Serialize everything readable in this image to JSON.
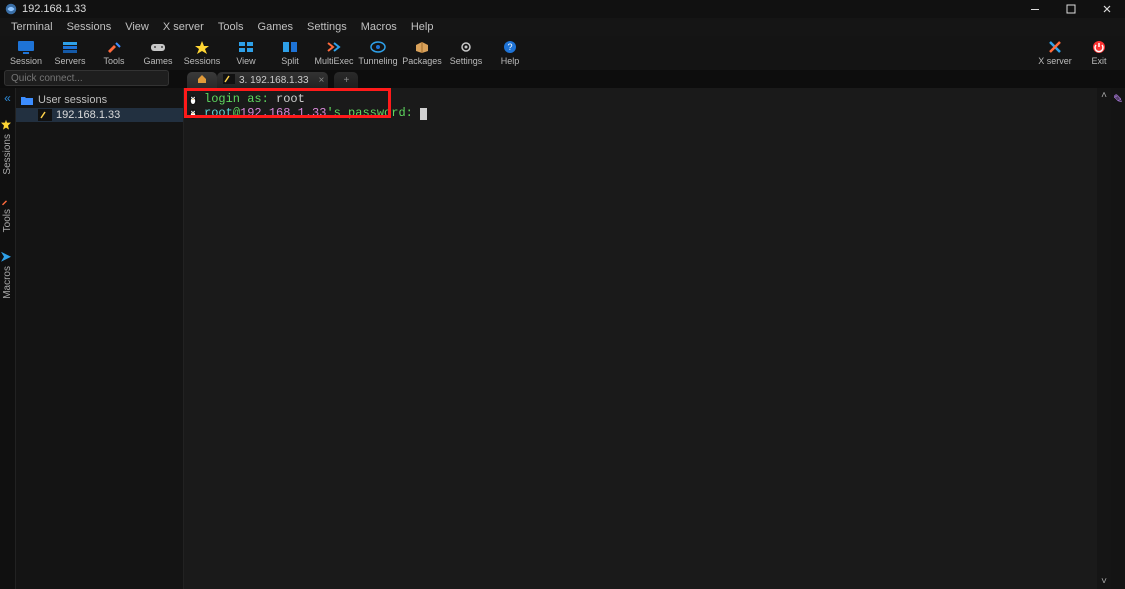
{
  "window": {
    "title": "192.168.1.33"
  },
  "menu": {
    "items": [
      "Terminal",
      "Sessions",
      "View",
      "X server",
      "Tools",
      "Games",
      "Settings",
      "Macros",
      "Help"
    ]
  },
  "toolbar": {
    "items": [
      {
        "id": "session",
        "label": "Session"
      },
      {
        "id": "servers",
        "label": "Servers"
      },
      {
        "id": "tools",
        "label": "Tools"
      },
      {
        "id": "games",
        "label": "Games"
      },
      {
        "id": "sessions",
        "label": "Sessions"
      },
      {
        "id": "view",
        "label": "View"
      },
      {
        "id": "split",
        "label": "Split"
      },
      {
        "id": "multiexec",
        "label": "MultiExec"
      },
      {
        "id": "tunneling",
        "label": "Tunneling"
      },
      {
        "id": "packages",
        "label": "Packages"
      },
      {
        "id": "settings",
        "label": "Settings"
      },
      {
        "id": "help",
        "label": "Help"
      }
    ],
    "right": [
      {
        "id": "xserver",
        "label": "X server"
      },
      {
        "id": "exit",
        "label": "Exit"
      }
    ]
  },
  "quickconnect": {
    "placeholder": "Quick connect..."
  },
  "tabs": {
    "active": {
      "label": "3. 192.168.1.33"
    }
  },
  "dock": {
    "items": [
      "Sessions",
      "Tools",
      "Macros"
    ]
  },
  "sidebar": {
    "group": "User sessions",
    "items": [
      {
        "label": "192.168.1.33"
      }
    ]
  },
  "terminal": {
    "line1_prefix": "login as: ",
    "line1_input": "root",
    "line2_user": "root",
    "line2_at": "@",
    "line2_host": "192.168.1.33",
    "line2_suffix": "'s password:"
  }
}
